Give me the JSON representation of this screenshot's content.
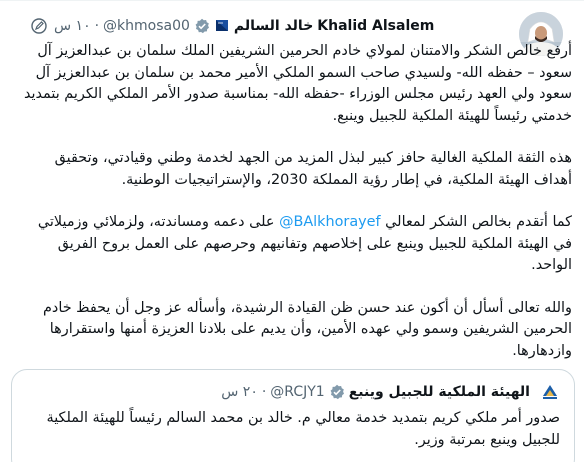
{
  "tweet": {
    "author_name_en": "Khalid Alsalem",
    "author_name_ar": "خالد السالم",
    "handle": "@khmosa00",
    "separator": "·",
    "time": "١٠ س",
    "paragraphs": [
      "أرفع خالص الشكر والامتنان لمولاي خادم الحرمين الشريفين الملك سلمان بن عبدالعزيز آل سعود – حفظه الله- ولسيدي صاحب السمو الملكي الأمير محمد بن سلمان بن عبدالعزيز آل سعود ولي العهد رئيس مجلس الوزراء -حفظه الله- بمناسبة صدور الأمر الملكي الكريم بتمديد خدمتي رئيساً للهيئة الملكية للجبيل وينبع.",
      "هذه الثقة الملكية الغالية حافز كبير لبذل المزيد من الجهد لخدمة وطني وقيادتي، وتحقيق أهداف الهيئة الملكية، في إطار رؤية المملكة 2030، والإستراتيجيات الوطنية.",
      {
        "before": "كما أتقدم بخالص الشكر لمعالي ",
        "mention": "@BAlkhorayef",
        "after": " على دعمه ومساندته، ولزملائي وزميلاتي في الهيئة الملكية للجبيل وينبع على إخلاصهم وتفانيهم وحرصهم على العمل بروح الفريق الواحد."
      },
      "والله تعالى أسأل أن أكون عند حسن ظن القيادة الرشيدة، وأسأله عز وجل أن يحفظ خادم الحرمين الشريفين وسمو ولي عهده الأمين، وأن يديم على بلادنا العزيزة أمنها واستقرارها وازدهارها."
    ]
  },
  "quote": {
    "name": "الهيئة الملكية للجبيل وينبع",
    "handle": "@RCJY1",
    "separator": "·",
    "time": "٢٠ س",
    "text": "صدور أمر ملكي كريم بتمديد خدمة معالي م. خالد بن محمد السالم رئيساً للهيئة الملكية للجبيل وينبع بمرتبة وزير."
  },
  "colors": {
    "text": "#0f1419",
    "secondary": "#536471",
    "link": "#1d9bf0",
    "verified_gold": "#e8b339",
    "verified_gray": "#829aab",
    "border": "#cfd9de"
  },
  "icons": {
    "avatar": "profile-photo",
    "flag": "saudi-flag-icon",
    "verified": "verified-badge-icon",
    "edit": "edit-history-icon",
    "quote_avatar": "rcjy-logo"
  }
}
